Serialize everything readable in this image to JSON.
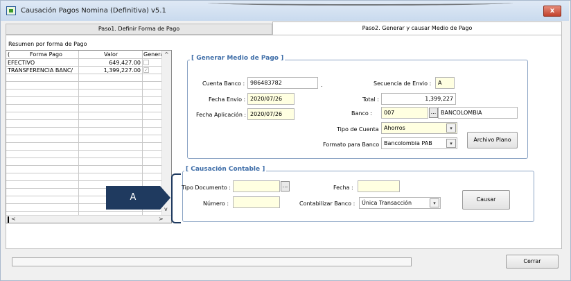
{
  "window": {
    "title": "Causación Pagos Nomina (Definitiva) v5.1",
    "close_label": "x"
  },
  "tabs": [
    {
      "label": "Paso1. Definir Forma de Pago",
      "active": false
    },
    {
      "label": "Paso2. Generar y causar Medio de Pago",
      "active": true
    }
  ],
  "resumen": {
    "label": "Resumen por forma de Pago",
    "columns": [
      "(",
      "Forma Pago",
      "Valor",
      "Genera"
    ],
    "rows": [
      {
        "forma_pago": "EFECTIVO",
        "valor": "649,427.00",
        "genera": false
      },
      {
        "forma_pago": "TRANSFERENCIA BANC/",
        "valor": "1,399,227.00",
        "genera": true
      }
    ]
  },
  "generar": {
    "title": "[ Generar Medio de Pago ]",
    "cuenta_banco_label": "Cuenta Banco :",
    "cuenta_banco": "986483782",
    "cuenta_banco_dot": ".",
    "secuencia_label": "Secuencia de Envio :",
    "secuencia": "A",
    "fecha_envio_label": "Fecha Envio :",
    "fecha_envio": "2020/07/26",
    "total_label": "Total :",
    "total": "1,399,227",
    "fecha_aplicacion_label": "Fecha Aplicación :",
    "fecha_aplicacion": "2020/07/26",
    "banco_label": "Banco :",
    "banco_code": "007",
    "banco_dots": "...",
    "banco_name": "BANCOLOMBIA",
    "tipo_cuenta_label": "Tipo de Cuenta :",
    "tipo_cuenta": "Ahorros",
    "formato_label": "Formato para Banco :",
    "formato": "Bancolombia PAB",
    "archivo_plano_label": "Archivo Plano"
  },
  "causacion": {
    "title": "[ Causación Contable ]",
    "tipo_documento_label": "Tipo Documento :",
    "tipo_documento": "",
    "tipo_documento_dots": "...",
    "fecha_label": "Fecha :",
    "fecha": "",
    "numero_label": "Número :",
    "numero": "",
    "contabilizar_label": "Contabilizar Banco :",
    "contabilizar": "Única Transacción",
    "causar_label": "Causar"
  },
  "annotation": {
    "label": "A"
  },
  "footer": {
    "progress": 0.0,
    "cerrar_label": "Cerrar"
  },
  "icons": {
    "select_arrow": "chevron-down-icon"
  }
}
